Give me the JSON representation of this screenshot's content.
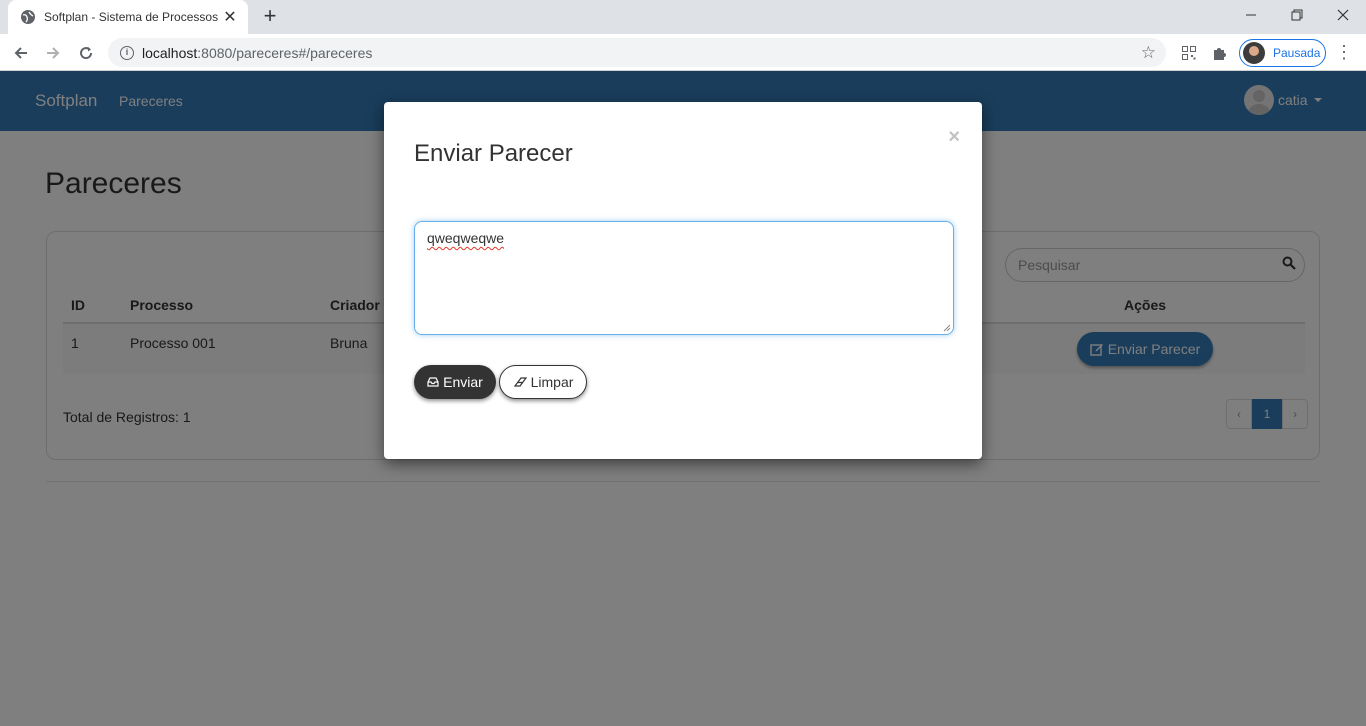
{
  "browser": {
    "tab_title": "Softplan - Sistema de Processos",
    "url_host": "localhost",
    "url_rest": ":8080/pareceres#/pareceres",
    "profile_label": "Pausada"
  },
  "navbar": {
    "brand": "Softplan",
    "link": "Pareceres",
    "user": "catia"
  },
  "page": {
    "title": "Pareceres",
    "search_placeholder": "Pesquisar",
    "table": {
      "headers": [
        "ID",
        "Processo",
        "Criador",
        "Ações"
      ],
      "rows": [
        {
          "id": "1",
          "processo": "Processo 001",
          "criador": "Bruna",
          "action_label": "Enviar Parecer"
        }
      ]
    },
    "total_label": "Total de Registros: 1",
    "pagination": {
      "prev": "‹",
      "current": "1",
      "next": "›"
    }
  },
  "modal": {
    "title": "Enviar Parecer",
    "close": "×",
    "textarea_value": "qweqweqwe",
    "send_label": "Enviar",
    "clear_label": "Limpar"
  }
}
